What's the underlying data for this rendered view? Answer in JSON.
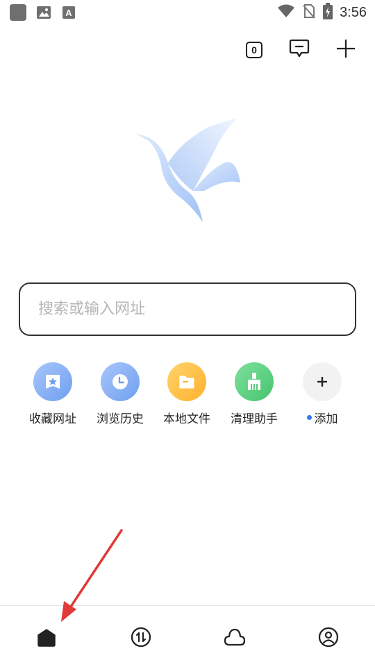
{
  "status_bar": {
    "time": "3:56",
    "icons": [
      "app-square-icon",
      "gallery-icon",
      "font-a-icon",
      "wifi-icon",
      "no-sim-icon",
      "battery-charging-icon"
    ]
  },
  "top_actions": {
    "tab_count": "0",
    "icons": [
      "tab-count-icon",
      "message-icon",
      "add-icon"
    ]
  },
  "search": {
    "placeholder": "搜索或输入网址",
    "value": ""
  },
  "shortcuts": [
    {
      "label": "收藏网址",
      "icon": "bookmark-star-icon",
      "color": "#7aa7f0"
    },
    {
      "label": "浏览历史",
      "icon": "clock-history-icon",
      "color": "#7aa7f0"
    },
    {
      "label": "本地文件",
      "icon": "folder-icon",
      "color": "#ffc043"
    },
    {
      "label": "清理助手",
      "icon": "broom-clean-icon",
      "color": "#5fd080"
    },
    {
      "label": "添加",
      "icon": "plus-icon",
      "color": "#f2f2f2",
      "badge_dot": true
    }
  ],
  "bottom_nav": [
    {
      "name": "home",
      "icon": "home-icon",
      "active": true
    },
    {
      "name": "transfer",
      "icon": "transfer-icon",
      "active": false
    },
    {
      "name": "cloud",
      "icon": "cloud-icon",
      "active": false
    },
    {
      "name": "profile",
      "icon": "profile-icon",
      "active": false
    }
  ],
  "colors": {
    "accent_dot": "#2f7bf5",
    "annotation_arrow": "#e03a3a"
  }
}
